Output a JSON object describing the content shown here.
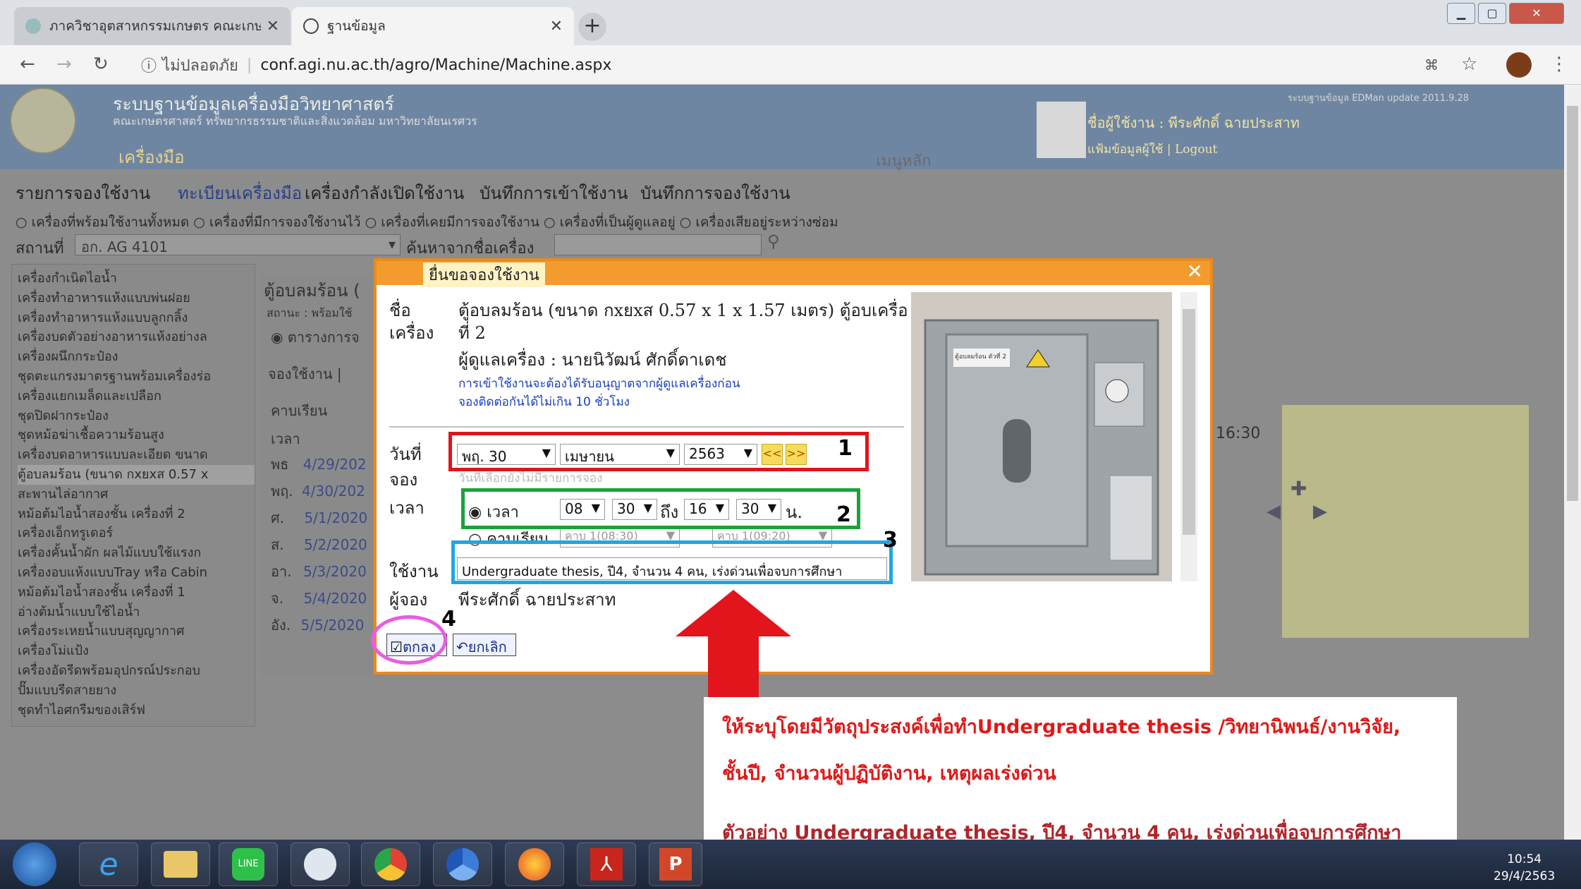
{
  "browser": {
    "tab1_title": "ภาควิชาอุตสาหกรรมเกษตร คณะเกษ...",
    "tab2_title": "ฐานข้อมูล",
    "insecure": "ไม่ปลอดภัย",
    "url": "conf.agi.nu.ac.th/agro/Machine/Machine.aspx"
  },
  "header": {
    "title": "ระบบฐานข้อมูลเครื่องมือวิทยาศาสตร์",
    "subtitle": "คณะเกษตรศาสตร์ ทรัพยากรธรรมชาติและสิ่งแวดล้อม มหาวิทยาลัยนเรศวร",
    "category": "เครื่องมือ",
    "main_menu": "เมนูหลัก",
    "version": "ระบบฐานข้อมูล EDMan update 2011.9.28",
    "user": "ชื่อผู้ใช้งาน : พีระศักดิ์ ฉายประสาท",
    "profile": "แฟ้มข้อมูลผู้ใช้",
    "sep": "|",
    "logout": "Logout"
  },
  "menu_tabs": [
    "รายการจองใช้งาน",
    "ทะเบียนเครื่องมือ",
    "เครื่องกำลังเปิดใช้งาน",
    "บันทึกการเข้าใช้งาน",
    "บันทึกการจองใช้งาน"
  ],
  "filters": "○ เครื่องที่พร้อมใช้งานทั้งหมด ○ เครื่องที่มีการจองใช้งานไว้ ○ เครื่องที่เคยมีการจองใช้งาน ○ เครื่องที่เป็นผู้ดูแลอยู่ ○ เครื่องเสียอยู่ระหว่างซ่อม",
  "location": {
    "label": "สถานที่",
    "value": "อก. AG 4101",
    "search_label": "ค้นหาจากชื่อเครื่อง"
  },
  "machines": [
    "เครื่องกำเนิดไอน้ำ",
    "เครื่องทำอาหารแห้งแบบพ่นฝอย",
    "เครื่องทำอาหารแห้งแบบลูกกลิ้ง",
    "เครื่องบดตัวอย่างอาหารแห้งอย่างล",
    "เครื่องผนึกกระป๋อง",
    "ชุดตะแกรงมาตรฐานพร้อมเครื่องร่อ",
    "เครื่องแยกเมล็ดและเปลือก",
    "ชุดปิดฝากระป๋อง",
    "ชุดหม้อฆ่าเชื้อความร้อนสูง",
    "เครื่องบดอาหารแบบละเอียด ขนาด",
    "ตู้อบลมร้อน (ขนาด กxยxส 0.57 x",
    "สะพานไล่อากาศ",
    "หม้อต้มไอน้ำสองชั้น เครื่องที่ 2",
    "เครื่องเอ็กทรูเดอร์",
    "เครื่องคั้นน้ำผัก ผลไม้แบบใช้แรงก",
    "เครื่องอบแห้งแบบTray หรือ Cabin",
    "หม้อต้มไอน้ำสองชั้น เครื่องที่ 1",
    "อ่างต้มน้ำแบบใช้ไอน้ำ",
    "เครื่องระเหยน้ำแบบสุญญากาศ",
    "เครื่องโม่แป้ง",
    "เครื่องอัดรีดพร้อมอุปกรณ์ประกอบ",
    "ปั๊มแบบรีดสายยาง",
    "ชุดทำไอศกรีมของเสิร์ฟ"
  ],
  "detail": {
    "title": "ตู้อบลมร้อน (",
    "status": "สถานะ : พร้อมใช้",
    "schedule_tab": "◉ ตารางการจ",
    "book_tab": "จองใช้งาน |",
    "period_header": "คาบเรียน",
    "time_header": "เวลา",
    "time_1630": "16:30",
    "rows": [
      {
        "day": "พธ",
        "date": "4/29/202"
      },
      {
        "day": "พฤ.",
        "date": "4/30/202"
      },
      {
        "day": "ศ.",
        "date": "5/1/2020"
      },
      {
        "day": "ส.",
        "date": "5/2/2020"
      },
      {
        "day": "อา.",
        "date": "5/3/2020"
      },
      {
        "day": "จ.",
        "date": "5/4/2020"
      },
      {
        "day": "อัง.",
        "date": "5/5/2020"
      }
    ]
  },
  "dialog": {
    "title": "ยื่นขอจองใช้งาน",
    "name_label_1": "ชื่อ",
    "name_label_2": "เครื่อง",
    "machine_name": "ตู้อบลมร้อน (ขนาด กxยxส 0.57 x 1 x 1.57 เมตร) ตู้อบเครื่อง",
    "machine_name_2": "ที่ 2",
    "supervisor": "ผู้ดูแลเครื่อง : นายนิวัฒน์ ศักดิ์ดาเดช",
    "note1": "การเข้าใช้งานจะต้องได้รับอนุญาตจากผู้ดูแลเครื่องก่อน",
    "note2": "จองติดต่อกันได้ไม่เกิน 10 ชั่วโมง",
    "date_label_1": "วันที่",
    "date_label_2": "จอง",
    "day": "พฤ. 30",
    "month": "เมษายน",
    "year": "2563",
    "prev": "<<",
    "next": ">>",
    "date_hint": "วันที่เลือกยังไม่มีรายการจอง",
    "time_label": "เวลา",
    "time_radio": "◉ เวลา",
    "start_h": "08",
    "start_m": "30",
    "to": "ถึง",
    "end_h": "16",
    "end_m": "30",
    "unit": "น.",
    "period_radio": "○ คาบเรียน",
    "period_start": "คาบ 1(08:30)",
    "period_end": "คาบ 1(09:20)",
    "use_label": "ใช้งาน",
    "use_value": "Undergraduate thesis, ปี4, จำนวน 4 คน, เร่งด่วนเพื่อจบการศึกษา",
    "booker_label": "ผู้จอง",
    "booker": "พีระศักดิ์ ฉายประสาท",
    "ok": "ตกลง",
    "cancel": "ยกเลิก",
    "photo_sign": "ตู้อบลมร้อน ตัวที่ 2"
  },
  "annotations": {
    "n1": "1",
    "n2": "2",
    "n3": "3",
    "n4": "4"
  },
  "callout": {
    "line1": "ให้ระบุโดยมีวัตถุประสงค์เพื่อทำUndergraduate thesis /วิทยานิพนธ์/งานวิจัย,",
    "line2": "ชั้นปี, จำนวนผู้ปฏิบัติงาน, เหตุผลเร่งด่วน",
    "example": "ตัวอย่าง  Undergraduate thesis, ปี4, จำนวน 4 คน, เร่งด่วนเพื่อจบการศึกษา"
  },
  "taskbar": {
    "time": "10:54",
    "date": "29/4/2563",
    "apps": [
      "start-icon",
      "ie-icon",
      "explorer-icon",
      "line-icon",
      "snipping-icon",
      "chrome-icon",
      "chrome-alt-icon",
      "firefox-icon",
      "acrobat-icon",
      "powerpoint-icon"
    ]
  },
  "colors": {
    "accent_red": "#e01818",
    "box_red": "#e0141c",
    "box_green": "#17a33a",
    "box_blue": "#1ea7e6",
    "box_pink": "#ea5ce0",
    "dialog_orange": "#f39b2d"
  }
}
